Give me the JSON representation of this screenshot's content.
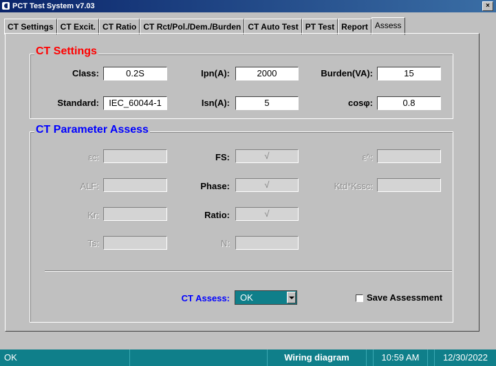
{
  "window": {
    "title": "PCT Test System v7.03",
    "close_glyph": "×"
  },
  "tabs": [
    "CT Settings",
    "CT Excit.",
    "CT Ratio",
    "CT Rct/Pol./Dem./Burden",
    "CT Auto Test",
    "PT Test",
    "Report",
    "Assess"
  ],
  "active_tab": "Assess",
  "ct_settings": {
    "legend": "CT Settings",
    "class_label": "Class:",
    "class_value": "0.2S",
    "ipn_label": "Ipn(A):",
    "ipn_value": "2000",
    "burden_label": "Burden(VA):",
    "burden_value": "15",
    "standard_label": "Standard:",
    "standard_value": "IEC_60044-1",
    "isn_label": "Isn(A):",
    "isn_value": "5",
    "cos_label": "cosφ:",
    "cos_value": "0.8"
  },
  "assess": {
    "legend": "CT Parameter Assess",
    "ec_label": "εc:",
    "ec_value": "",
    "fs_label": "FS:",
    "fs_value": "√",
    "eh_label": "ε^:",
    "eh_value": "",
    "alf_label": "ALF:",
    "alf_value": "",
    "phase_label": "Phase:",
    "phase_value": "√",
    "ktd_label": "Ktd*Kssc:",
    "ktd_value": "",
    "kr_label": "Kr:",
    "kr_value": "",
    "ratio_label": "Ratio:",
    "ratio_value": "√",
    "ts_label": "Ts:",
    "ts_value": "",
    "n_label": "N:",
    "n_value": "",
    "ct_assess_label": "CT Assess:",
    "ct_assess_value": "OK",
    "save_label": "Save Assessment"
  },
  "statusbar": {
    "status": "OK",
    "wiring": "Wiring diagram",
    "time": "10:59 AM",
    "date": "12/30/2022"
  },
  "colors": {
    "red": "#ff0000",
    "blue": "#0000ff",
    "teal": "#0f7f8a"
  }
}
